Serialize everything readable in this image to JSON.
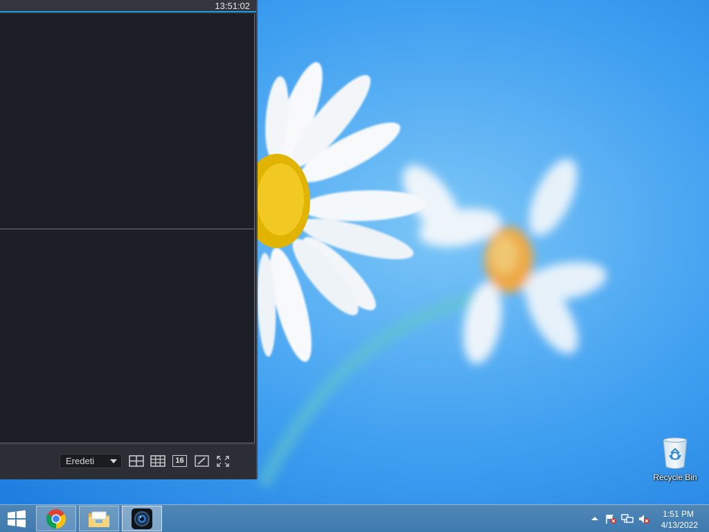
{
  "viewer": {
    "clock": "13:51:02",
    "toolbar": {
      "view_mode_value": "Eredeti",
      "grid_16_label": "16"
    }
  },
  "desktop": {
    "recycle_bin_label": "Recycle Bin"
  },
  "taskbar": {
    "apps": [
      {
        "name": "Google Chrome",
        "icon": "chrome-icon"
      },
      {
        "name": "File Explorer",
        "icon": "folder-icon"
      },
      {
        "name": "Camera Viewer",
        "icon": "camera-icon",
        "active": true
      }
    ],
    "tray": {
      "time": "1:51 PM",
      "date": "4/13/2022"
    }
  },
  "colors": {
    "accent": "#1aa0e6",
    "viewer_bg": "#2b2e34",
    "pane_bg": "#1b1e25",
    "taskbar": "#3f7ab0"
  }
}
